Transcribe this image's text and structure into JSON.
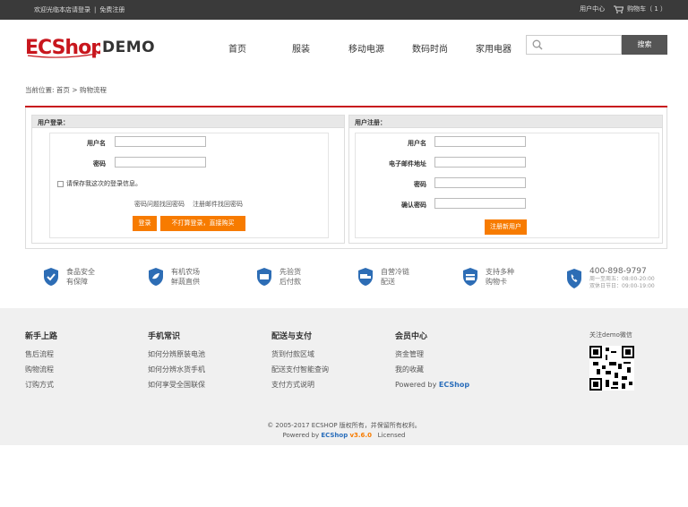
{
  "topbar": {
    "welcome": "欢迎光临本店请登录",
    "register_link": "免费注册",
    "user_center": "用户中心",
    "cart": "购物车（ 1 ）"
  },
  "logo": {
    "ec": "ECShop",
    "demo": "DEMO"
  },
  "nav": {
    "items": [
      "首页",
      "服装",
      "移动电源",
      "数码时尚",
      "家用电器"
    ]
  },
  "search": {
    "placeholder": "",
    "button": "搜索"
  },
  "breadcrumb": "当前位置: 首页 > 购物流程",
  "login": {
    "title": "用户登录：",
    "username_label": "用户名",
    "password_label": "密码",
    "remember": "请保存我这次的登录信息。",
    "link_question": "密码问题找回密码",
    "link_email": "注册邮件找回密码",
    "login_btn": "登录",
    "guest_btn": "不打算登录，直接购买"
  },
  "register": {
    "title": "用户注册：",
    "username_label": "用户名",
    "email_label": "电子邮件地址",
    "password_label": "密码",
    "confirm_label": "确认密码",
    "submit_btn": "注册新用户"
  },
  "features": [
    {
      "line1": "食品安全",
      "line2": "有保障",
      "icon": "shield-check-icon"
    },
    {
      "line1": "有机农场",
      "line2": "鲜蔬直供",
      "icon": "leaf-shield-icon"
    },
    {
      "line1": "先验货",
      "line2": "后付款",
      "icon": "inspect-icon"
    },
    {
      "line1": "自营冷链",
      "line2": "配送",
      "icon": "truck-icon"
    },
    {
      "line1": "支持多种",
      "line2": "购物卡",
      "icon": "card-icon"
    }
  ],
  "hotline": {
    "number": "400-898-9797",
    "line1": "周一至周五：08:00-20:00",
    "line2": "双休日节日：09:00-19:00"
  },
  "footer": {
    "cols": [
      {
        "title": "新手上路",
        "items": [
          "售后流程",
          "购物流程",
          "订购方式"
        ]
      },
      {
        "title": "手机常识",
        "items": [
          "如何分辨原装电池",
          "如何分辨水货手机",
          "如何享受全国联保"
        ]
      },
      {
        "title": "配送与支付",
        "items": [
          "货到付款区域",
          "配送支付智能查询",
          "支付方式说明"
        ]
      },
      {
        "title": "会员中心",
        "items": [
          "资金管理",
          "我的收藏"
        ],
        "powered_prefix": "Powered by ",
        "powered_brand": "ECShop"
      }
    ],
    "qr_label": "关注demo微信",
    "copyright": "© 2005-2017 ECSHOP 版权所有，并保留所有权利。",
    "powered_prefix": "Powered by ",
    "powered_brand": "ECShop",
    "version": "v3.6.0",
    "license": "Licensed"
  },
  "colors": {
    "brand": "#c8161d",
    "accent": "#f77b00",
    "topbar": "#3a3a3a"
  }
}
